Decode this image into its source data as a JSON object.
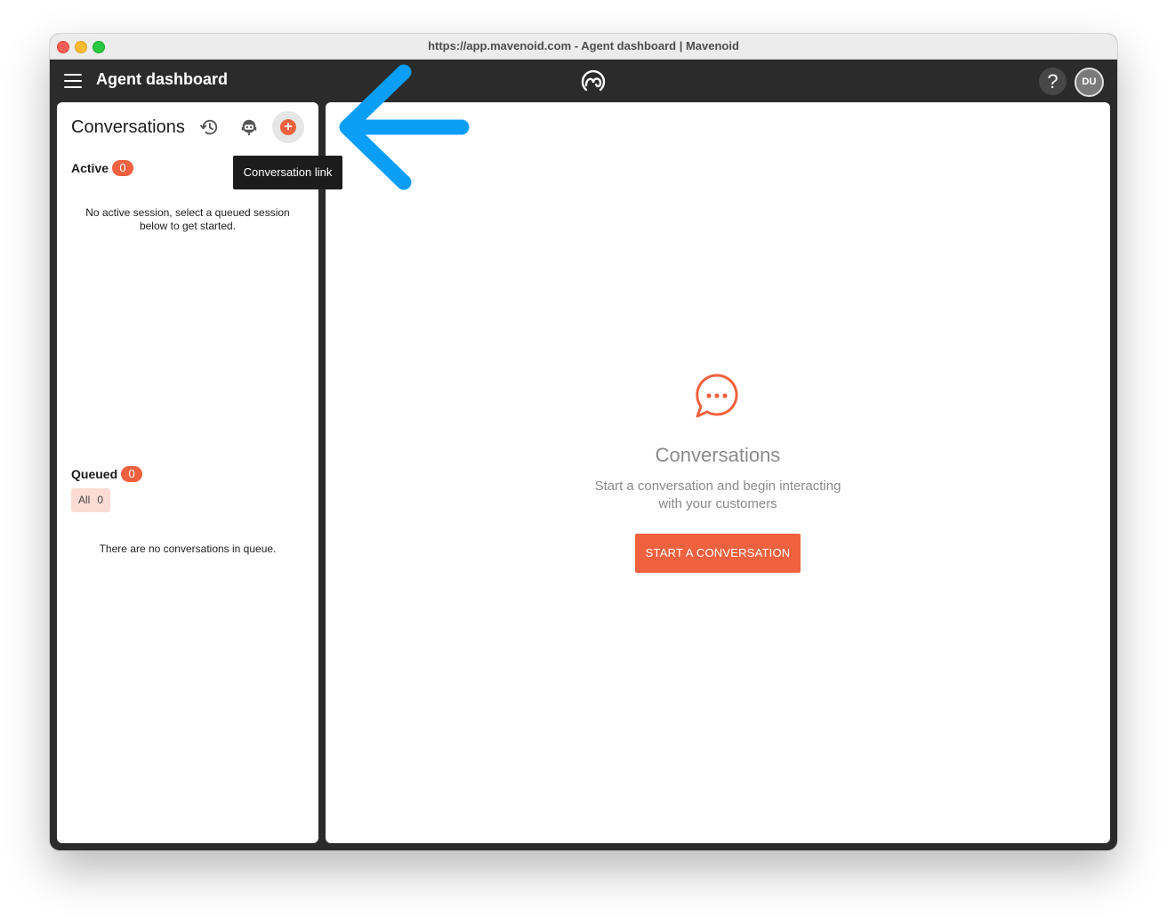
{
  "window": {
    "title": "https://app.mavenoid.com - Agent dashboard | Mavenoid"
  },
  "appbar": {
    "title": "Agent dashboard",
    "help_label": "?",
    "avatar_initials": "DU"
  },
  "sidebar": {
    "title": "Conversations",
    "tooltip": "Conversation link",
    "add_button_glyph": "+",
    "active": {
      "label": "Active",
      "count": "0",
      "empty_message": "No active session, select a queued session below to get started."
    },
    "queued": {
      "label": "Queued",
      "count": "0",
      "filter": {
        "label": "All",
        "count": "0"
      },
      "empty_message": "There are no conversations in queue."
    }
  },
  "main": {
    "empty_title": "Conversations",
    "empty_description": "Start a conversation and begin interacting with your customers",
    "start_button": "START A CONVERSATION"
  },
  "colors": {
    "accent": "#f0613f",
    "appbar": "#2b2b2b",
    "annotation_arrow": "#0a9ef7",
    "chip_bg": "#fbdcd4"
  },
  "icons": {
    "menu": "hamburger-icon",
    "logo": "mavenoid-logo",
    "history": "history-icon",
    "agent": "agent-icon",
    "add": "plus-icon",
    "chat": "chat-bubble-icon",
    "annotation": "arrow-left-annotation"
  }
}
